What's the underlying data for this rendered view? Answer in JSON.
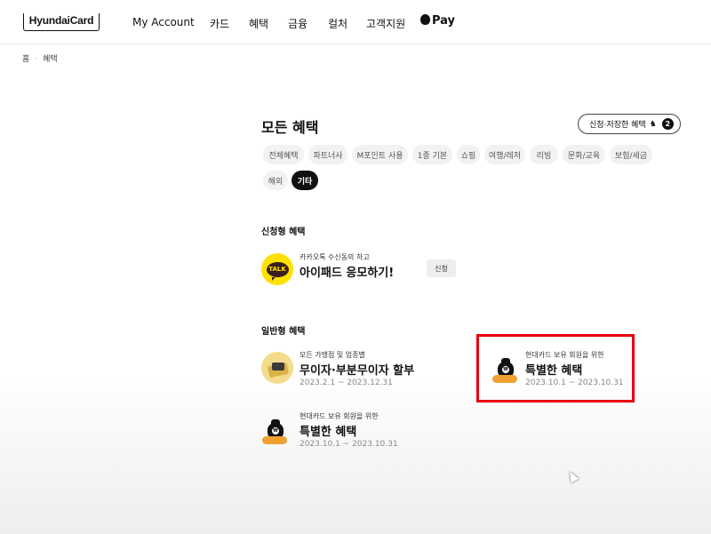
{
  "header": {
    "logo_text": "HyundaiCard",
    "nav": [
      "My Account",
      "카드",
      "혜택",
      "금융",
      "컬처",
      "고객지원"
    ],
    "pay_label": "Pay"
  },
  "breadcrumb": [
    "홈",
    "혜택"
  ],
  "page": {
    "title": "모든 혜택",
    "saved_button_label": "신청·저장한 혜택",
    "saved_count": "2"
  },
  "filters": {
    "chips": [
      "전체혜택",
      "파트너사",
      "M포인트 사용",
      "1종 기본",
      "쇼핑",
      "여행/레저",
      "리빙",
      "문화/교육",
      "보험/세금",
      "해외",
      "기타"
    ],
    "active": "기타"
  },
  "sections": {
    "apply_title": "신청형 혜택",
    "general_title": "일반형 혜택"
  },
  "apply_benefit": {
    "icon": "kakao-talk-icon",
    "icon_text": "TALK",
    "subtitle": "카카오톡 수신동의 하고",
    "title": "아이패드 응모하기!",
    "button": "신청"
  },
  "general_benefits": [
    {
      "icon": "wallet-card-icon",
      "subtitle": "모든 가맹점 및 업종별",
      "title": "무이자·부분무이자 할부",
      "period": "2023.2.1 ~ 2023.12.31"
    },
    {
      "icon": "money-bag-icon",
      "subtitle": "현대카드 보유 회원을 위한",
      "title": "특별한 혜택",
      "period": "2023.10.1 ~ 2023.10.31"
    },
    {
      "icon": "money-bag-icon",
      "subtitle": "현대카드 보유 회원을 위한",
      "title": "특별한 혜택",
      "period": "2023.10.1 ~ 2023.10.31"
    }
  ],
  "colors": {
    "highlight": "#e8000b",
    "kakao_yellow": "#ffe100",
    "chip_active": "#111111"
  }
}
